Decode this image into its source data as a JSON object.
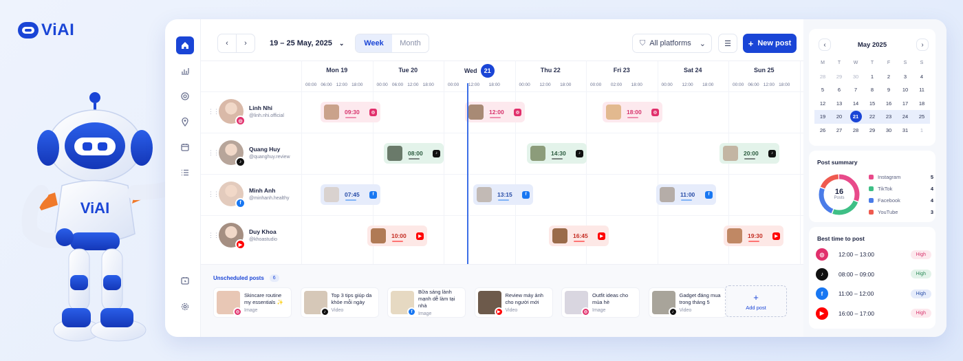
{
  "brand": {
    "name": "ViAI",
    "robot_chest": "ViAI"
  },
  "colors": {
    "primary": "#1a45d6",
    "instagram": "#e1306c",
    "tiktok": "#111111",
    "facebook": "#1877f2",
    "youtube": "#ff0000"
  },
  "nav": [
    {
      "name": "home-icon",
      "active": true
    },
    {
      "name": "analytics-icon"
    },
    {
      "name": "target-icon"
    },
    {
      "name": "location-icon"
    },
    {
      "name": "calendar-icon"
    },
    {
      "name": "list-icon"
    },
    {
      "name": "calendar-clock-icon"
    },
    {
      "name": "settings-icon"
    }
  ],
  "toolbar": {
    "date_range": "19 – 25 May, 2025",
    "view_week": "Week",
    "view_month": "Month",
    "filter": "All platforms",
    "new_post": "New post"
  },
  "days": [
    {
      "label": "Mon 19"
    },
    {
      "label": "Tue 20"
    },
    {
      "label": "Wed",
      "day_num": "21",
      "today": true
    },
    {
      "label": "Thu 22"
    },
    {
      "label": "Fri 23"
    },
    {
      "label": "Sat 24"
    },
    {
      "label": "Sun 25"
    }
  ],
  "time_ticks": [
    "00:00",
    "06:00",
    "12:00",
    "18:00",
    "00:00",
    "06:00",
    "12:00",
    "18:00",
    "00:00",
    "12:00",
    "18:00",
    "00:00",
    "12:00",
    "18:00",
    "00:00",
    "02:00",
    "18:00",
    "00:00",
    "12:00",
    "18:00",
    "00:00",
    "06:00",
    "12:00",
    "18:00"
  ],
  "accounts": [
    {
      "name": "Linh Nhi",
      "handle": "@linh.nhi.official",
      "platform": "instagram",
      "posts": [
        "09:30",
        "12:00",
        "18:00"
      ]
    },
    {
      "name": "Quang Huy",
      "handle": "@quanghuy.review",
      "platform": "tiktok",
      "posts": [
        "08:00",
        "14:30",
        "20:00"
      ]
    },
    {
      "name": "Minh Anh",
      "handle": "@minhanh.healthy",
      "platform": "facebook",
      "posts": [
        "07:45",
        "13:15",
        "11:00"
      ]
    },
    {
      "name": "Duy Khoa",
      "handle": "@khoastudio",
      "platform": "youtube",
      "posts": [
        "10:00",
        "16:45",
        "19:30"
      ]
    }
  ],
  "unscheduled": {
    "title": "Unscheduled posts",
    "count": "6",
    "items": [
      {
        "title": "Skincare routine my essentials ✨",
        "type": "Image",
        "platform": "instagram"
      },
      {
        "title": "Top 3 tips giúp da khỏe mỗi ngày",
        "type": "Video",
        "platform": "tiktok"
      },
      {
        "title": "Bữa sáng lành mạnh dễ làm tại nhà",
        "type": "Image",
        "platform": "facebook"
      },
      {
        "title": "Review máy ảnh cho người mới",
        "type": "Video",
        "platform": "youtube"
      },
      {
        "title": "Outfit ideas cho mùa hè",
        "type": "Image",
        "platform": "instagram"
      },
      {
        "title": "Gadget đáng mua trong tháng 5",
        "type": "Video",
        "platform": "tiktok"
      }
    ],
    "add_label": "Add post"
  },
  "calendar": {
    "month": "May 2025",
    "weekdays": [
      "M",
      "T",
      "W",
      "T",
      "F",
      "S",
      "S"
    ],
    "weeks": [
      [
        "28",
        "29",
        "30",
        "1",
        "2",
        "3",
        "4"
      ],
      [
        "5",
        "6",
        "7",
        "8",
        "9",
        "10",
        "11"
      ],
      [
        "12",
        "13",
        "14",
        "15",
        "16",
        "17",
        "18"
      ],
      [
        "19",
        "20",
        "21",
        "22",
        "23",
        "24",
        "25"
      ],
      [
        "26",
        "27",
        "28",
        "29",
        "30",
        "31",
        "1"
      ]
    ],
    "selected": "21"
  },
  "summary": {
    "title": "Post summary",
    "total": "16",
    "total_label": "Posts",
    "items": [
      {
        "label": "Instagram",
        "value": 5,
        "color": "#e84a8a"
      },
      {
        "label": "TikTok",
        "value": 4,
        "color": "#3fbf86"
      },
      {
        "label": "Facebook",
        "value": 4,
        "color": "#4a7ce8"
      },
      {
        "label": "YouTube",
        "value": 3,
        "color": "#ef5a4f"
      }
    ]
  },
  "best_time": {
    "title": "Best time to post",
    "rows": [
      {
        "platform": "instagram",
        "time": "12:00 – 13:00",
        "level": "High"
      },
      {
        "platform": "tiktok",
        "time": "08:00 – 09:00",
        "level": "High"
      },
      {
        "platform": "facebook",
        "time": "11:00 – 12:00",
        "level": "High"
      },
      {
        "platform": "youtube",
        "time": "16:00 – 17:00",
        "level": "High"
      }
    ]
  }
}
